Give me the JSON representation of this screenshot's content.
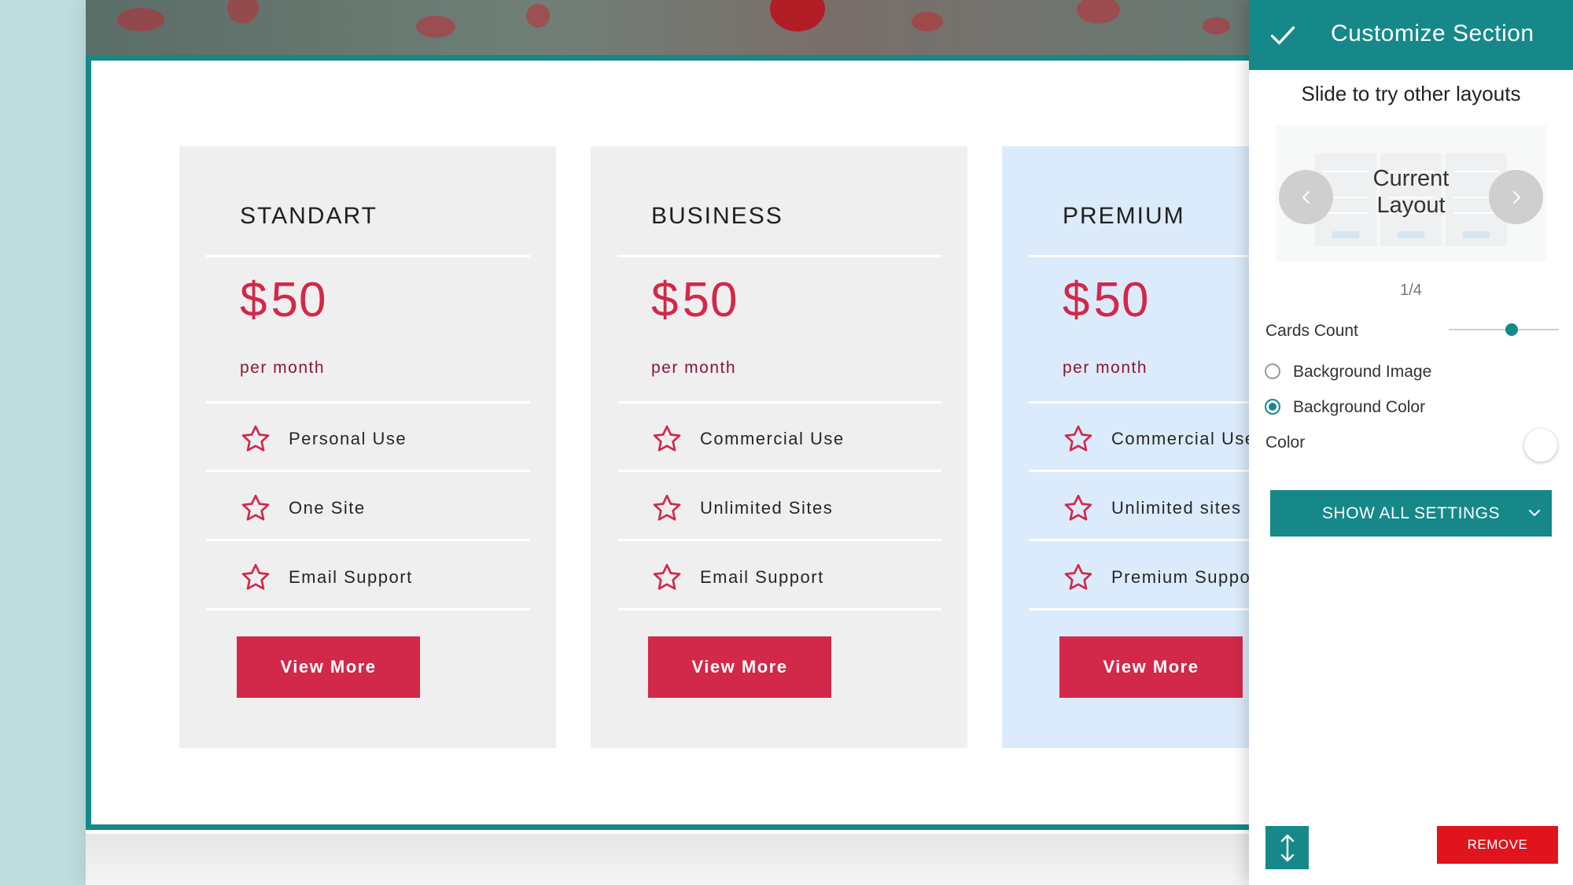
{
  "cards": [
    {
      "title": "STANDART",
      "currency": "$",
      "price": "50",
      "period": "per month",
      "features": [
        "Personal Use",
        "One Site",
        "Email Support"
      ],
      "button_label": "View More"
    },
    {
      "title": "BUSINESS",
      "currency": "$",
      "price": "50",
      "period": "per month",
      "features": [
        "Commercial Use",
        "Unlimited Sites",
        "Email Support"
      ],
      "button_label": "View More"
    },
    {
      "title": "PREMIUM",
      "currency": "$",
      "price": "50",
      "period": "per month",
      "features": [
        "Commercial Use",
        "Unlimited sites",
        "Premium Suppor"
      ],
      "button_label": "View More"
    }
  ],
  "panel": {
    "title": "Customize Section",
    "slide_hint": "Slide to try other layouts",
    "layout_label_line1": "Current",
    "layout_label_line2": "Layout",
    "layout_counter": "1/4",
    "cards_count_label": "Cards Count",
    "cards_count_level": 0.57,
    "bg_image_label": "Background Image",
    "bg_color_label": "Background Color",
    "bg_selected": "Background Color",
    "color_label": "Color",
    "color_value": "#ffffff",
    "show_all_label": "SHOW ALL SETTINGS",
    "remove_label": "REMOVE"
  },
  "colors": {
    "accent": "#16888a",
    "brand_red": "#d2284a",
    "remove_red": "#e0141c",
    "card_bg": "#efefef",
    "premium_bg": "#dcebfb"
  },
  "icons": {
    "feature": "star-outline-icon",
    "confirm": "check-icon",
    "prev": "chevron-left-icon",
    "next": "chevron-right-icon",
    "dropdown": "chevron-down-icon",
    "move": "vertical-arrows-icon"
  }
}
